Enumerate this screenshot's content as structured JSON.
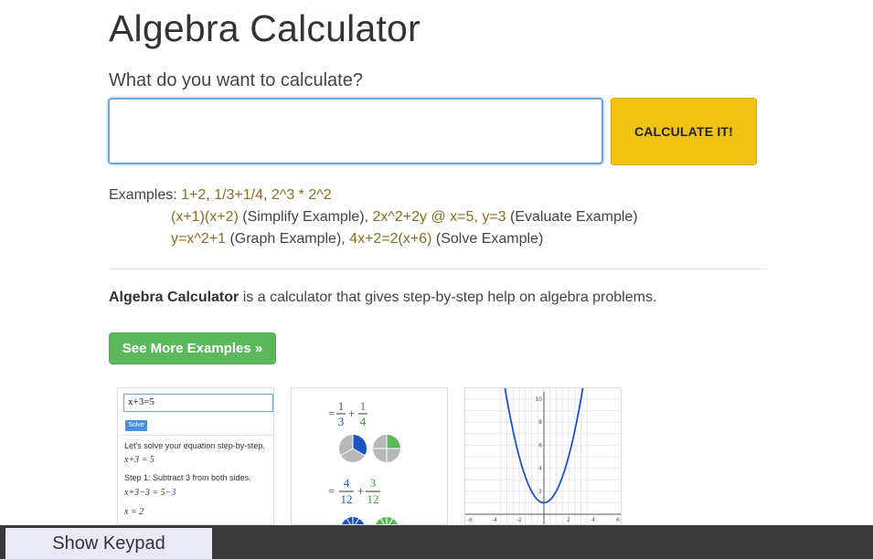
{
  "page": {
    "title": "Algebra Calculator",
    "prompt": "What do you want to calculate?",
    "input_value": "",
    "calculate_label": "CALCULATE IT!"
  },
  "examples": {
    "lead": "Examples:",
    "ex1": "1+2",
    "ex2": "1/3+1/4",
    "ex3": "2^3 * 2^2",
    "ex4": "(x+1)(x+2)",
    "ex4_note": "(Simplify Example)",
    "ex5": "2x^2+2y @ x=5, y=3",
    "ex5_note": "(Evaluate Example)",
    "ex6": "y=x^2+1",
    "ex6_note": "(Graph Example)",
    "ex7": "4x+2=2(x+6)",
    "ex7_note": "(Solve Example)"
  },
  "description": {
    "bold": "Algebra Calculator",
    "rest": "is a calculator that gives step-by-step help on algebra problems."
  },
  "see_more_label": "See More Examples »",
  "thumb1": {
    "input": "x+3=5",
    "solve": "Solve",
    "line1": "Let's solve your equation step-by-step.",
    "line2": "x+3 = 5",
    "line3": "Step 1: Subtract 3 from both sides.",
    "line4a": "x+3−3 = 5−",
    "line4b": "3",
    "line5": "x = 2"
  },
  "thumb2": {
    "f1n": "1",
    "f1d": "3",
    "f2n": "1",
    "f2d": "4",
    "f3n": "4",
    "f3d": "12",
    "f4n": "3",
    "f4d": "12",
    "eq": "=",
    "plus": "+"
  },
  "thumb3": {
    "y_ticks": [
      "10",
      "8",
      "6",
      "4",
      "2"
    ],
    "x_ticks": [
      "-6",
      "-4",
      "-2",
      "2",
      "4",
      "6"
    ]
  },
  "keypad_label": "Show Keypad",
  "colors": {
    "calculate_button": "#f2c213",
    "see_more_button": "#5cb85c",
    "example_link": "#8a6d1f",
    "keypad_bar": "#3a3a3a",
    "graph_curve": "#1a55c5"
  }
}
